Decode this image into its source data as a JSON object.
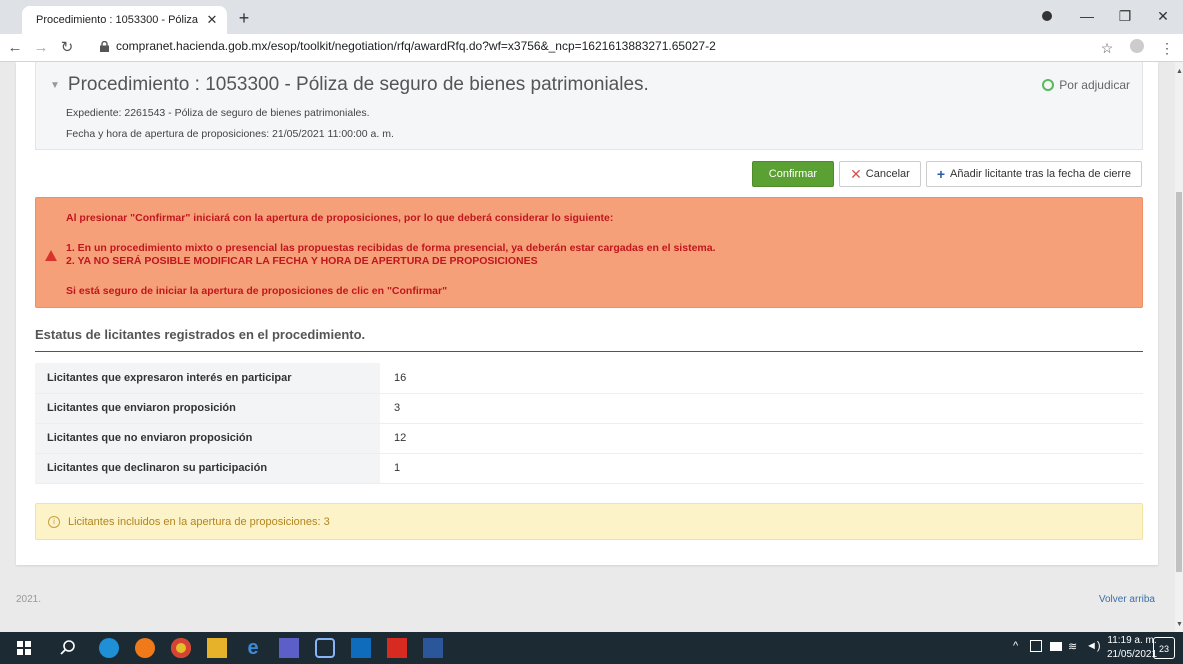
{
  "browser": {
    "tab_title": "Procedimiento : 1053300 - Póliza",
    "url": "compranet.hacienda.gob.mx/esop/toolkit/negotiation/rfq/awardRfq.do?wf=x3756&_ncp=1621613883271.65027-2"
  },
  "procedure": {
    "title": "Procedimiento : 1053300 - Póliza de seguro de bienes patrimoniales.",
    "status": "Por adjudicar",
    "expediente": "Expediente: 2261543 - Póliza de seguro de bienes patrimoniales.",
    "apertura": "Fecha y hora de apertura de proposiciones: 21/05/2021 11:00:00 a. m."
  },
  "actions": {
    "confirm": "Confirmar",
    "cancel": "Cancelar",
    "add": "Añadir licitante tras la fecha de cierre"
  },
  "alert": {
    "intro": "Al presionar \"Confirmar\" iniciará con la apertura de proposiciones, por lo que deberá considerar lo siguiente:",
    "item1": "1. En un procedimiento mixto o presencial las propuestas recibidas de forma presencial, ya deberán estar cargadas en el sistema.",
    "item2": "2. YA NO SERÁ POSIBLE MODIFICAR LA FECHA Y HORA DE APERTURA DE PROPOSICIONES",
    "closing": "Si está seguro de iniciar la apertura de proposiciones de clic en \"Confirmar\""
  },
  "stats": {
    "title": "Estatus de licitantes registrados en el procedimiento.",
    "rows": [
      {
        "label": "Licitantes que expresaron interés en participar",
        "value": "16"
      },
      {
        "label": "Licitantes que enviaron proposición",
        "value": "3"
      },
      {
        "label": "Licitantes que no enviaron proposición",
        "value": "12"
      },
      {
        "label": "Licitantes que declinaron su participación",
        "value": "1"
      }
    ]
  },
  "info": "Licitantes incluidos en la apertura de proposiciones: 3",
  "footer": {
    "year": "2021.",
    "back_to_top": "Volver arriba"
  },
  "taskbar": {
    "time": "11:19 a. m.",
    "date": "21/05/2021",
    "notifications": "23"
  },
  "colors": {
    "confirm": "#5ba032",
    "alert_bg": "#f6a07a",
    "alert_text": "#c0161c",
    "info_bg": "#fcf3c9"
  }
}
